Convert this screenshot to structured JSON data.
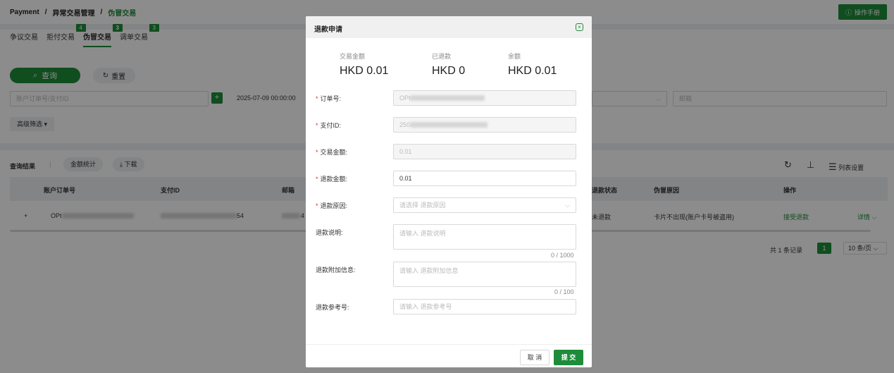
{
  "breadcrumb": {
    "root": "Payment",
    "sep": "/",
    "level2": "异常交易管理",
    "current": "伪冒交易"
  },
  "manual_button": "操作手册",
  "tabs": [
    {
      "label": "争议交易",
      "badge": ""
    },
    {
      "label": "拒付交易",
      "badge": "4"
    },
    {
      "label": "伪冒交易",
      "badge": "3"
    },
    {
      "label": "调单交易",
      "badge": "3"
    }
  ],
  "filters": {
    "query_label": "查询",
    "reset_label": "重置",
    "order_placeholder": "账户订单号/支付ID",
    "date_value": "2025-07-09 00:00:00",
    "email_placeholder": "邮箱",
    "advanced_label": "高级筛选"
  },
  "results": {
    "label": "查询结果",
    "sep": "|",
    "stats_button": "金额统计",
    "download_button": "下载",
    "columns_button": "列表设置",
    "columns": {
      "order": "账户订单号",
      "pay_id": "支付ID",
      "email": "邮箱",
      "refund_status": "退款状态",
      "reason": "伪冒原因",
      "actions": "操作"
    },
    "row": {
      "expand": "+",
      "order": "OPt",
      "pay_id_suffix": "54",
      "email_suffix": "4",
      "refund_status": "未退款",
      "reason": "卡片不出现(账户卡号被盗用)",
      "accept": "接受退款",
      "detail": "详情"
    }
  },
  "pagination": {
    "total": "共 1 条记录",
    "page": "1",
    "size": "10 条/页"
  },
  "modal": {
    "title": "退款申请",
    "summary": [
      {
        "label": "交易金额",
        "value": "HKD 0.01"
      },
      {
        "label": "已退款",
        "value": "HKD 0"
      },
      {
        "label": "余额",
        "value": "HKD 0.01"
      }
    ],
    "required_mark": "*",
    "fields": {
      "order_label": "订单号:",
      "order_value": "OPt",
      "payid_label": "支付ID:",
      "payid_value": "250",
      "amount_label": "交易金额:",
      "amount_value": "0.01",
      "refund_label": "退款金额:",
      "refund_value": "0.01",
      "reason_label": "退款原因:",
      "reason_placeholder": "请选择 退款原因",
      "desc_label": "退款说明:",
      "desc_placeholder": "请输入 退款说明",
      "desc_counter": "0 / 1000",
      "extra_label": "退款附加信息:",
      "extra_placeholder": "请输入 退款附加信息",
      "extra_counter": "0 / 100",
      "ref_label": "退款参考号:",
      "ref_placeholder": "请输入 退款参考号"
    },
    "cancel": "取 消",
    "submit": "提 交"
  },
  "colors": {
    "brand": "#1e8c3a",
    "required": "#e0302b"
  }
}
